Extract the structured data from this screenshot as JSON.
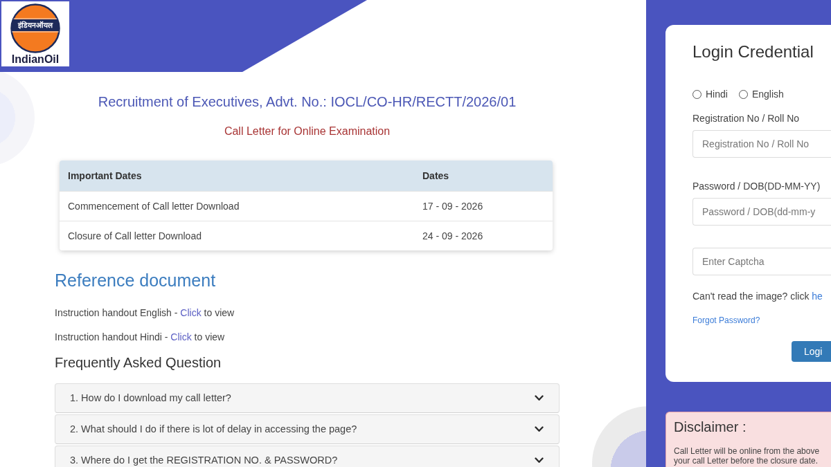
{
  "header": {
    "logo": {
      "emblem_text": "इंडियनऑयल",
      "wordmark": "IndianOil"
    }
  },
  "main": {
    "title": "Recruitment of Executives, Advt. No.: IOCL/CO-HR/RECTT/2026/01",
    "subtitle": "Call Letter for Online Examination",
    "dates_table": {
      "columns": [
        "Important Dates",
        "Dates"
      ],
      "rows": [
        [
          "Commencement of Call letter Download",
          "17 - 09 - 2026"
        ],
        [
          "Closure of Call letter Download",
          "24 - 09 - 2026"
        ]
      ]
    },
    "reference": {
      "heading": "Reference document",
      "items": [
        {
          "text": "Instruction handout English -",
          "link": "Click",
          "after": "to view"
        },
        {
          "text": "Instruction handout Hindi -",
          "link": "Click",
          "after": "to view"
        }
      ]
    },
    "faq": {
      "heading": "Frequently Asked Question",
      "items": [
        {
          "question": "1. How do I download my call letter?",
          "expanded": false
        },
        {
          "question": "2. What should I do if there is lot of delay in accessing the page?",
          "expanded": false
        },
        {
          "question": "3. Where do I get the REGISTRATION NO. & PASSWORD?",
          "expanded": false
        }
      ]
    }
  },
  "login": {
    "title": "Login Credential",
    "language_options": [
      {
        "label": "Hindi",
        "selected": false
      },
      {
        "label": "English",
        "selected": false
      }
    ],
    "fields": [
      {
        "label": "Registration No / Roll No",
        "placeholder": "Registration No / Roll No"
      },
      {
        "label": "Password / DOB(DD-MM-YY)",
        "placeholder": "Password / DOB(dd-mm-y"
      },
      {
        "placeholder": "Enter Captcha"
      }
    ],
    "captcha_help": {
      "text": "Can't read the image? click",
      "link": "he"
    },
    "forgot_password": "Forgot Password?",
    "login_button": "Logi"
  },
  "disclaimer": {
    "title": "Disclaimer :",
    "lines": [
      "Call Letter will be online from the above",
      "your call Letter before the closure date."
    ]
  }
}
